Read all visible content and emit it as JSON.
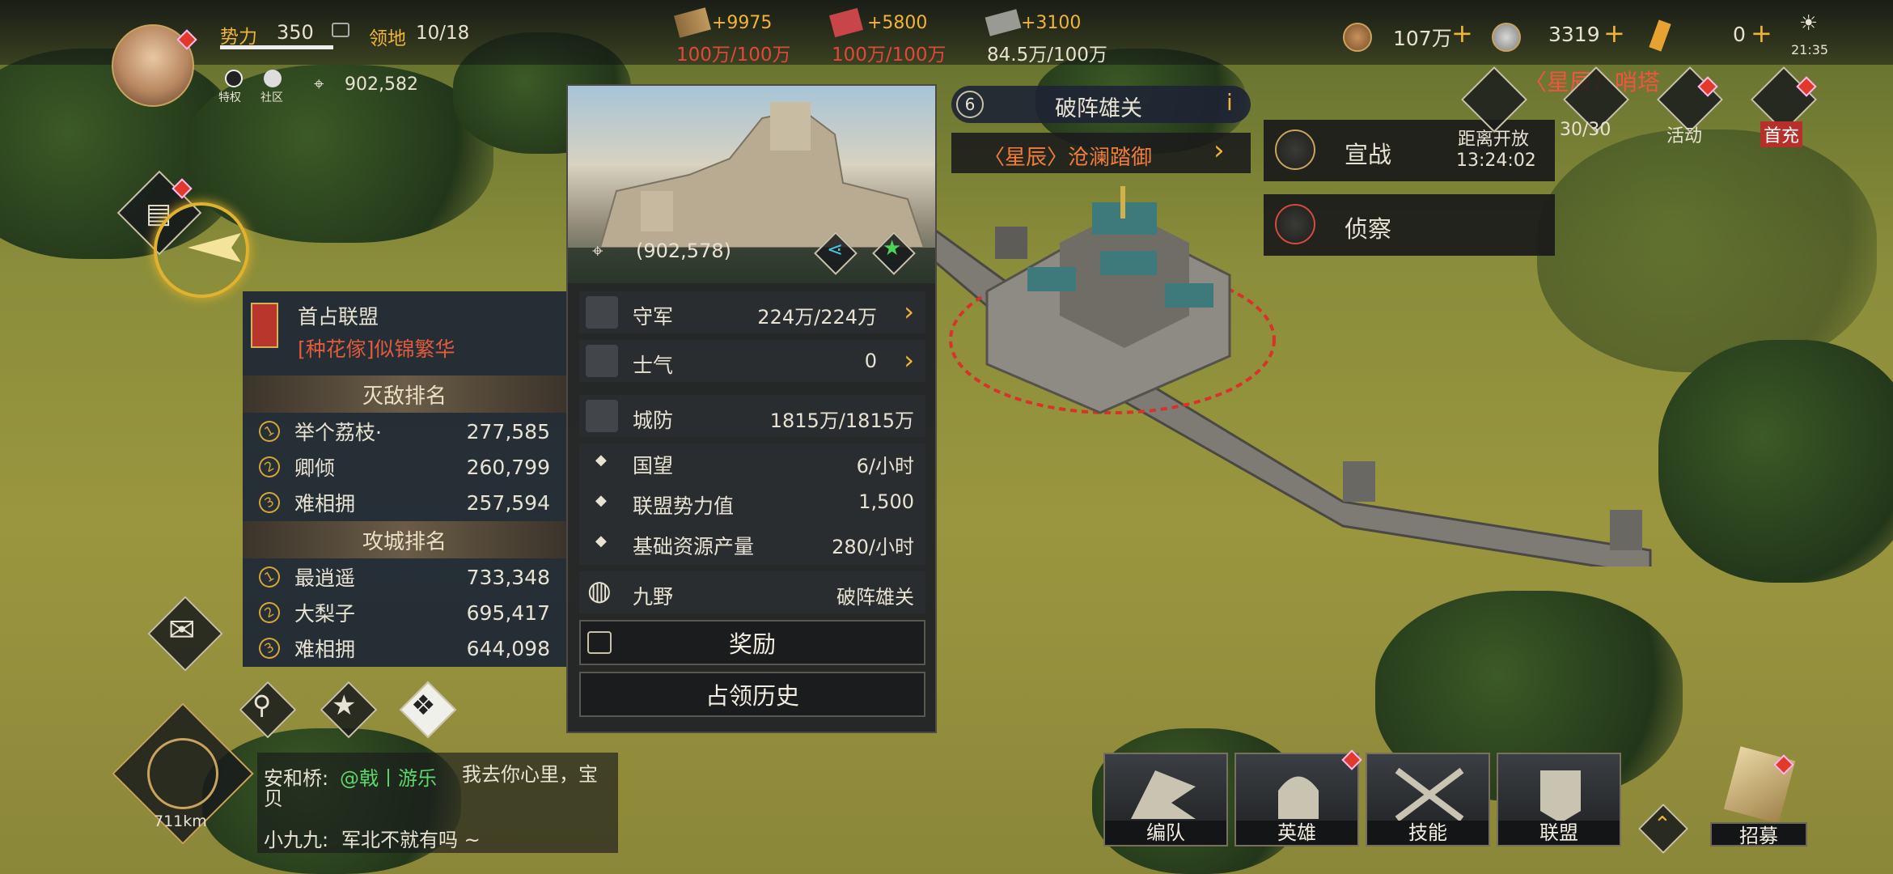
{
  "player": {
    "power_label": "势力",
    "power_value": "350",
    "territory_label": "领地",
    "territory_value": "10/18",
    "privilege_label": "特权",
    "community_label": "社区",
    "coords": "902,582"
  },
  "resources": [
    {
      "icon": "wood-icon",
      "gain": "+9975",
      "amount": "100万/100万"
    },
    {
      "icon": "iron-icon",
      "gain": "+5800",
      "amount": "100万/100万"
    },
    {
      "icon": "stone-icon",
      "gain": "+3100",
      "amount": "84.5万/100万"
    }
  ],
  "currencies": [
    {
      "icon": "copper-coin-icon",
      "value": "107万"
    },
    {
      "icon": "silver-coin-icon",
      "value": "3319"
    },
    {
      "icon": "jade-icon",
      "value": "0"
    }
  ],
  "clock": "21:35",
  "city": {
    "level": "6",
    "name": "破阵雄关",
    "alliance_tag": "〈星辰〉沧澜踏御",
    "coords": "(902,578)",
    "occupier_label": "首占联盟",
    "occupier": "[种花傢]似锦繁华"
  },
  "kill_ranking": {
    "title": "灭敌排名",
    "entries": [
      {
        "rank": "1",
        "name": "举个荔枝·",
        "value": "277,585"
      },
      {
        "rank": "2",
        "name": "卿倾",
        "value": "260,799"
      },
      {
        "rank": "3",
        "name": "难相拥",
        "value": "257,594"
      }
    ]
  },
  "siege_ranking": {
    "title": "攻城排名",
    "entries": [
      {
        "rank": "1",
        "name": "最逍遥",
        "value": "733,348"
      },
      {
        "rank": "2",
        "name": "大梨子",
        "value": "695,417"
      },
      {
        "rank": "3",
        "name": "难相拥",
        "value": "644,098"
      }
    ]
  },
  "stats": {
    "garrison_label": "守军",
    "garrison_value": "224万/224万",
    "morale_label": "士气",
    "morale_value": "0",
    "defense_label": "城防",
    "defense_value": "1815万/1815万",
    "prestige_label": "国望",
    "prestige_value": "6/小时",
    "alliance_power_label": "联盟势力值",
    "alliance_power_value": "1,500",
    "base_output_label": "基础资源产量",
    "base_output_value": "280/小时",
    "region_label": "九野",
    "region_value": "破阵雄关"
  },
  "buttons": {
    "reward": "奖励",
    "history": "占领历史",
    "declare_war": "宣战",
    "scout": "侦察",
    "countdown_label": "距离开放",
    "countdown": "13:24:02"
  },
  "top_right": {
    "tower_label": "〈星辰〉哨塔",
    "troops": "30/30",
    "activity": "活动",
    "first_recharge": "首充"
  },
  "chat": [
    {
      "user": "安和桥:",
      "tag": "@戟丨游乐",
      "text": "我去你心里，宝贝"
    },
    {
      "user": "小九九:",
      "text": "军北不就有吗 ~"
    }
  ],
  "compass_distance": "711km",
  "bottom_nav": [
    {
      "label": "编队",
      "icon": "formation-icon"
    },
    {
      "label": "英雄",
      "icon": "hero-helmet-icon"
    },
    {
      "label": "技能",
      "icon": "crossed-swords-icon"
    },
    {
      "label": "联盟",
      "icon": "alliance-banner-icon"
    }
  ],
  "recruit": "招募"
}
